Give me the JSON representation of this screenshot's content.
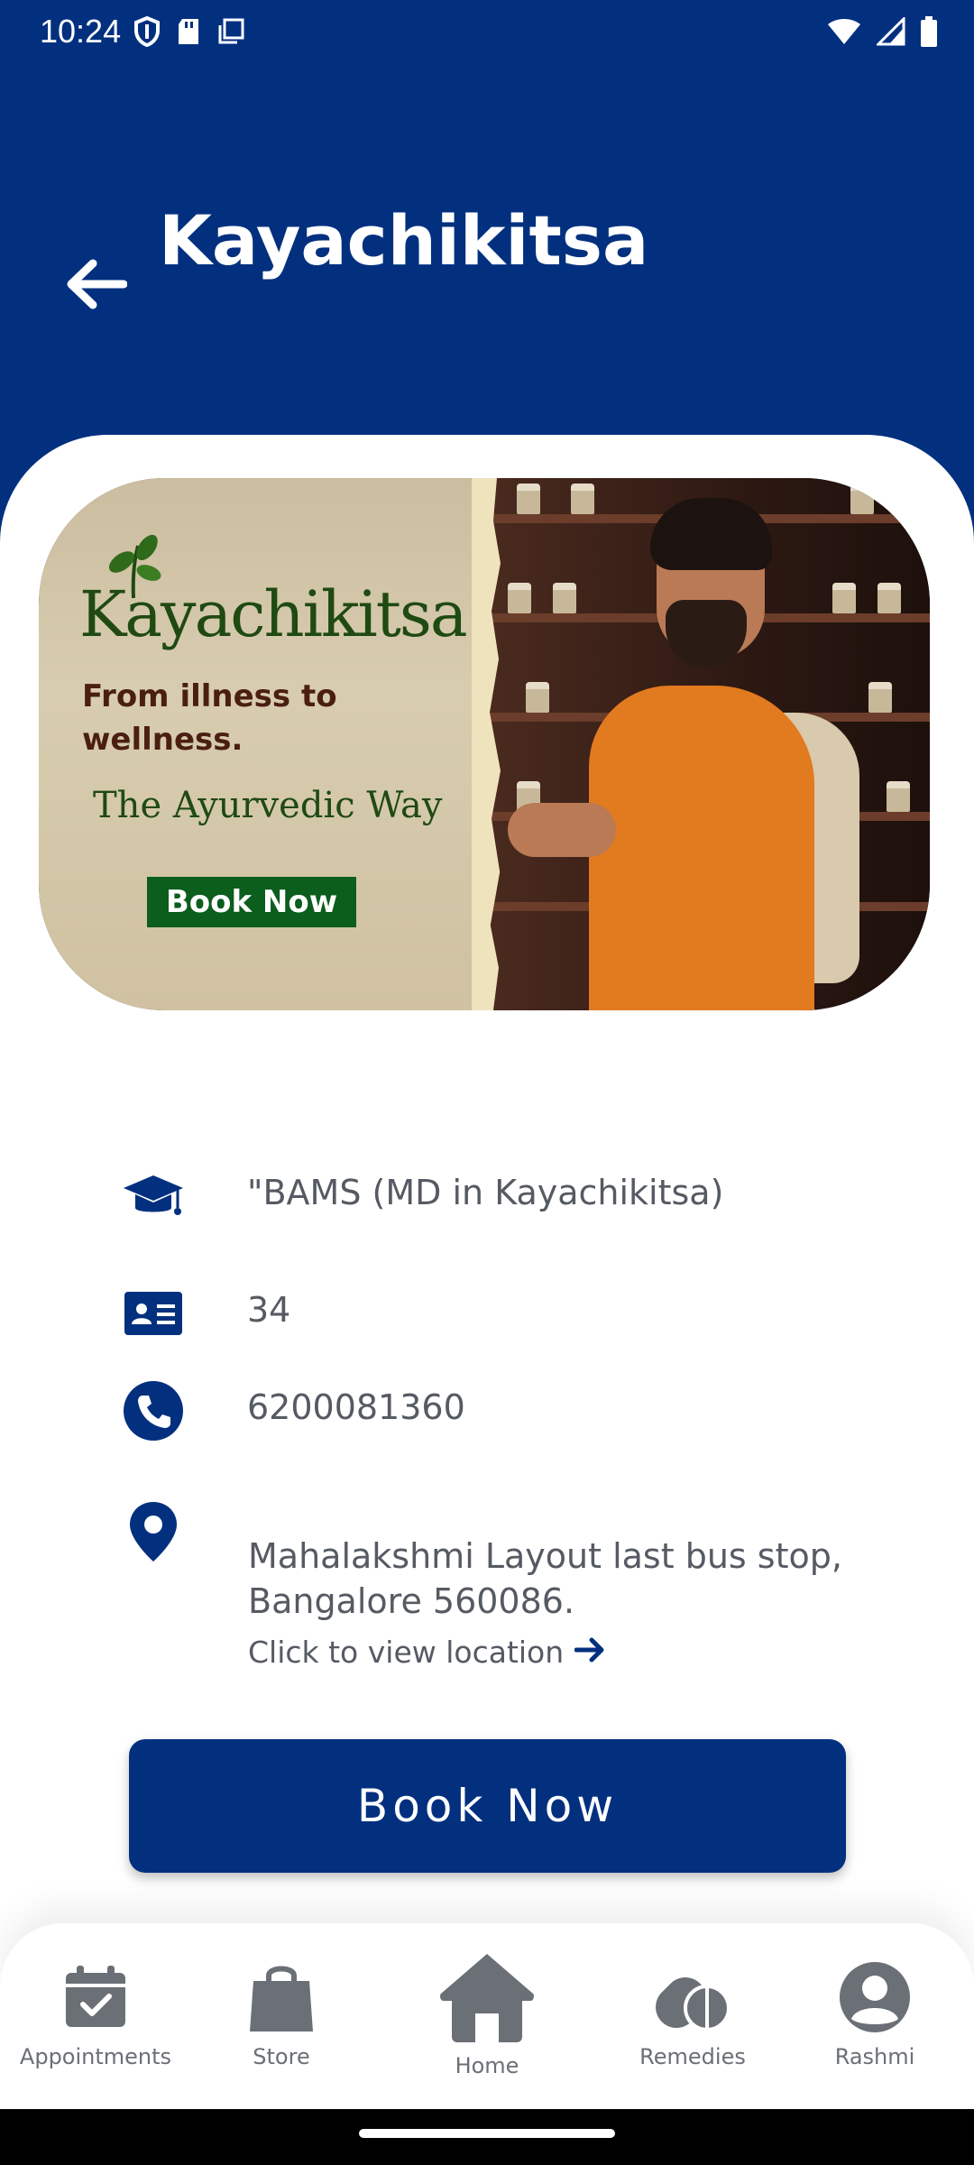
{
  "status_bar": {
    "time": "10:24",
    "left_icons": [
      "shield-icon",
      "sd-card-icon",
      "copy-icon"
    ],
    "right_icons": [
      "wifi-icon",
      "signal-icon",
      "battery-icon"
    ]
  },
  "header": {
    "title": "Kayachikitsa",
    "back_icon": "arrow-left-icon",
    "background_color": "#02307f"
  },
  "banner": {
    "brand": "Kayachikitsa",
    "tagline": "From illness to wellness.",
    "subtitle": "The Ayurvedic Way",
    "cta_label": "Book Now"
  },
  "doctor_info": {
    "qualification": "\"BAMS (MD in Kayachikitsa)",
    "experience": "34",
    "phone": "6200081360",
    "address": "Mahalakshmi Layout last bus stop, Bangalore 560086.",
    "location_link": "Click to view location"
  },
  "book_button": {
    "label": "Book Now"
  },
  "bottom_nav": {
    "items": [
      {
        "label": "Appointments",
        "icon": "calendar-check-icon"
      },
      {
        "label": "Store",
        "icon": "shopping-bag-icon"
      },
      {
        "label": "Home",
        "icon": "home-icon"
      },
      {
        "label": "Remedies",
        "icon": "pills-icon"
      },
      {
        "label": "Rashmi",
        "icon": "user-circle-icon"
      }
    ]
  },
  "colors": {
    "primary": "#02307f",
    "text_secondary": "#555a63",
    "nav_icon": "#6b6f76"
  }
}
